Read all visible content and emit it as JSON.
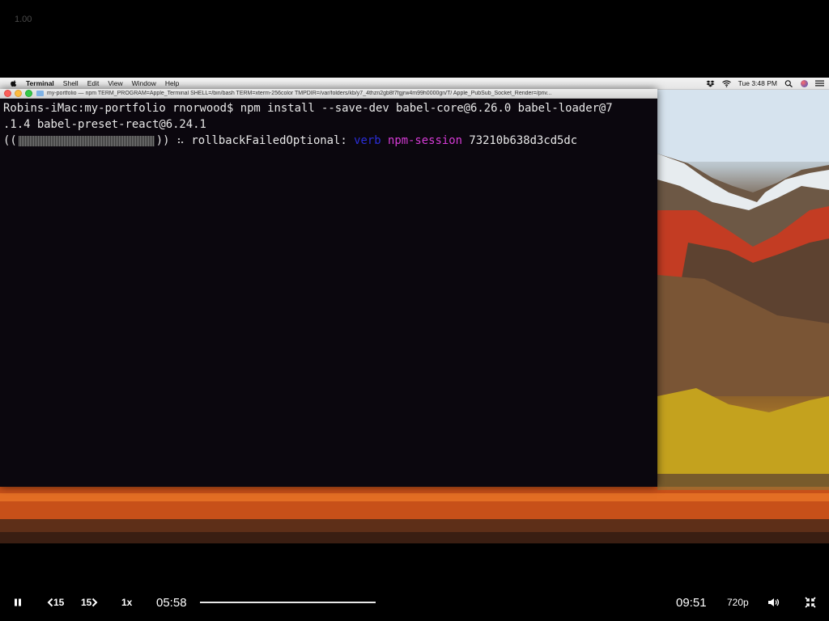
{
  "overlay": {
    "zoom_level": "1.00"
  },
  "menubar": {
    "items": [
      "Terminal",
      "Shell",
      "Edit",
      "View",
      "Window",
      "Help"
    ],
    "clock": "Tue 3:48 PM"
  },
  "terminal": {
    "title": "my-portfolio — npm TERM_PROGRAM=Apple_Terminal SHELL=/bin/bash TERM=xterm-256color TMPDIR=/var/folders/kb/y7_4thzn2gb8f7fgjrw4m99h0000gn/T/ Apple_PubSub_Socket_Render=/priv...",
    "line1": "Robins-iMac:my-portfolio rnorwood$ npm install --save-dev babel-core@6.26.0 babel-loader@7",
    "line2": ".1.4 babel-preset-react@6.24.1",
    "progress_open": "((",
    "progress_close": "))",
    "spinner": "⠦",
    "stage": "rollbackFailedOptional:",
    "verb": "verb",
    "session_label": "npm-session",
    "session_id": "73210b638d3cd5dc"
  },
  "player": {
    "rewind_label": "15",
    "forward_label": "15",
    "speed": "1x",
    "current_time": "05:58",
    "duration": "09:51",
    "quality": "720p",
    "progress_fraction": 1.0
  },
  "colors": {
    "terminal_bg": "#0b070e",
    "verb": "#2b2ed8",
    "npm_session": "#d63bd6"
  }
}
